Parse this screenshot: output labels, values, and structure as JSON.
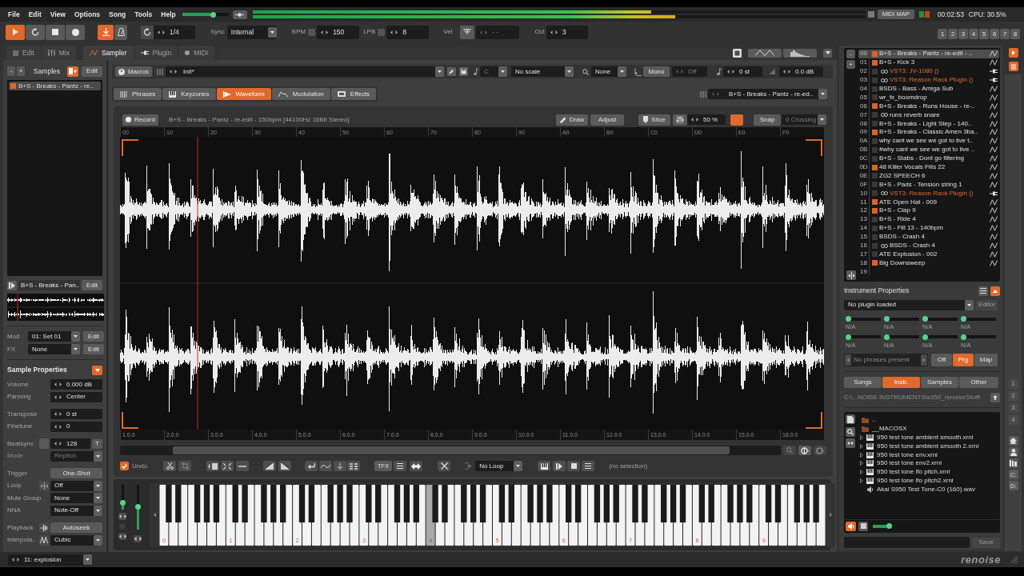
{
  "menu_bar": {
    "items": [
      "File",
      "Edit",
      "View",
      "Options",
      "Song",
      "Tools",
      "Help"
    ],
    "master_volume": {
      "level": 0.7
    },
    "meters": [
      {
        "level": 0.65
      },
      {
        "level": 0.69
      }
    ],
    "midi_map": "MIDI MAP",
    "indicators": [
      {
        "color": "#2e8b3a"
      },
      {
        "color": "#b8461e"
      }
    ],
    "time": "00:02:53",
    "cpu": "CPU: 30.5%"
  },
  "transport": {
    "buttons": [
      {
        "kind": "play",
        "on": true
      },
      {
        "kind": "loop",
        "on": false
      },
      {
        "kind": "stop",
        "on": false
      },
      {
        "kind": "record",
        "on": false
      }
    ],
    "follow": {
      "on": true
    },
    "metronome": {
      "on": false
    },
    "block_loop": "1/4",
    "sync": {
      "label": "Sync",
      "value": "Internal"
    },
    "bpm": {
      "label": "BPM",
      "checked": false,
      "value": "150"
    },
    "lpb": {
      "label": "LPB",
      "checked": false,
      "value": "8"
    },
    "velocity": {
      "label": "Vel",
      "value": "- -",
      "disabled": true
    },
    "octave": {
      "label": "Oct",
      "value": "3"
    },
    "pattern_buttons": [
      "1",
      "2",
      "3",
      "4",
      "5",
      "6",
      "7",
      "8"
    ]
  },
  "view_tabs": [
    {
      "label": "Edit",
      "selected": false
    },
    {
      "label": "Mix",
      "selected": false
    }
  ],
  "editor_tabs": [
    {
      "label": "Sampler",
      "selected": true
    },
    {
      "label": "Plugin",
      "selected": false
    },
    {
      "label": "MIDI",
      "selected": false
    }
  ],
  "samples": {
    "remove": "-",
    "add": "+",
    "title": "Samples",
    "edit": "Edit",
    "items": [
      {
        "name": "B+S - Breaks - Pantz - re..",
        "color": "#e0692c",
        "selected": true
      }
    ],
    "current": {
      "name": "B+S - Breaks - Pan..",
      "edit": "Edit"
    },
    "mod": {
      "label": "Mod",
      "value": "01: Set 01",
      "edit": "Edit"
    },
    "fx": {
      "label": "FX",
      "value": "None",
      "edit": "Edit"
    }
  },
  "sample_properties": {
    "title": "Sample Properties",
    "groups": [
      [
        {
          "label": "Volume",
          "kind": "spinner",
          "value": "0.000 dB",
          "disabled": false
        },
        {
          "label": "Panning",
          "kind": "spinner",
          "value": "Center",
          "disabled": false
        }
      ],
      [
        {
          "label": "Transpose",
          "kind": "spinner",
          "value": "0 st",
          "disabled": false
        },
        {
          "label": "Finetune",
          "kind": "spinner",
          "value": "0",
          "disabled": false
        }
      ],
      [
        {
          "label": "Beatsync",
          "kind": "spinner",
          "value": "128",
          "disabled": false,
          "checkbox": {
            "checked": false
          },
          "toggle": "T"
        },
        {
          "label": "Mode",
          "kind": "dropdown",
          "value": "Repitch",
          "disabled": true
        }
      ],
      [
        {
          "label": "Trigger",
          "kind": "button",
          "value": "One-Shot",
          "disabled": false
        },
        {
          "label": "Loop",
          "kind": "dropdown",
          "value": "Off",
          "disabled": false
        },
        {
          "label": "Mute Group",
          "kind": "dropdown",
          "value": "None",
          "disabled": false
        },
        {
          "label": "NNA",
          "kind": "dropdown",
          "value": "Note-Off",
          "disabled": false
        }
      ],
      [
        {
          "label": "Playback",
          "kind": "button",
          "value": "Autoseek",
          "disabled": false
        },
        {
          "label": "Interpola..",
          "kind": "dropdown",
          "value": "Cubic",
          "disabled": false
        }
      ]
    ]
  },
  "instrument_bar": {
    "macros": "Macros",
    "preset": "Init*",
    "key": {
      "value": "C",
      "disabled": true
    },
    "scale": "No scale",
    "quantize": "None",
    "mono": "Mono",
    "glide": {
      "value": "Off",
      "disabled": true
    },
    "transpose": "0 st",
    "volume": "0.0 dB"
  },
  "sampler_tabs": [
    {
      "label": "Phrases",
      "selected": false
    },
    {
      "label": "Keyzones",
      "selected": false
    },
    {
      "label": "Waveform",
      "selected": true
    },
    {
      "label": "Modulation",
      "selected": false
    },
    {
      "label": "Effects",
      "selected": false
    }
  ],
  "sample_selector": "B+S - Breaks - Pantz - re-ed..",
  "waveform_editor": {
    "record": "Record",
    "title": "B+S - Breaks - Pantz - re-edit - 150bpm [44100Hz 16Bit Stereo]",
    "draw": "Draw",
    "adjust": "Adjust",
    "slice": "Slice",
    "amount": "50 %",
    "toggle": {
      "on": true
    },
    "snap": "Snap",
    "snap_mode": {
      "value": "0 Crossing",
      "disabled": true
    },
    "top_ruler": [
      "00",
      "10",
      "20",
      "30",
      "40",
      "50",
      "60",
      "70",
      "80",
      "90",
      "A0",
      "B0",
      "C0",
      "D0",
      "E0",
      "F0"
    ],
    "bottom_ruler": [
      "1.0.0",
      "2.0.0",
      "3.0.0",
      "4.0.0",
      "5.0.0",
      "6.0.0",
      "7.0.0",
      "8.0.0",
      "9.0.0",
      "10.0.0",
      "11.0.0",
      "12.0.0",
      "13.0.0",
      "14.0.0",
      "15.0.0",
      "16.0.0"
    ],
    "undo": {
      "label": "Undo",
      "checked": true
    },
    "tfx": "TFX",
    "loop_mode": "No Loop",
    "selection": "(no selection)"
  },
  "keyboard": {
    "wheels": [
      {
        "level": 0.17
      },
      {
        "level": 0.5
      }
    ],
    "octaves": [
      {
        "label": "0",
        "selected": false
      },
      {
        "label": "1",
        "selected": false
      },
      {
        "label": "2",
        "selected": false
      },
      {
        "label": "3",
        "selected": false
      },
      {
        "label": "4",
        "selected": true
      },
      {
        "label": "5",
        "selected": false
      },
      {
        "label": "6",
        "selected": false
      },
      {
        "label": "7",
        "selected": false
      },
      {
        "label": "8",
        "selected": false
      },
      {
        "label": "9",
        "selected": false
      }
    ]
  },
  "instruments": [
    {
      "number": "00",
      "kind": "sample",
      "name": "B+S - Breaks - Pantz - re-edit - ..",
      "color": "#d9632a",
      "linked": false,
      "selected": true
    },
    {
      "number": "01",
      "kind": "sample",
      "name": "B+S - Kick 3",
      "color": "#d9632a",
      "linked": false,
      "selected": false
    },
    {
      "number": "02",
      "kind": "plugin",
      "name": "VST3: JV-1080 ()",
      "color": "#383838",
      "linked": true,
      "selected": false
    },
    {
      "number": "03",
      "kind": "plugin",
      "name": "VST3: Reason Rack Plugin ()",
      "color": "#383838",
      "linked": true,
      "selected": false
    },
    {
      "number": "04",
      "kind": "sample",
      "name": "BSDS - Bass - Amiga Sub",
      "color": "#383838",
      "linked": false,
      "selected": false
    },
    {
      "number": "05",
      "kind": "sample",
      "name": "wr_fx_boomdrop",
      "color": "#383838",
      "linked": false,
      "selected": false
    },
    {
      "number": "06",
      "kind": "sample",
      "name": "B+S - Breaks - Runs House - re-..",
      "color": "#d9632a",
      "linked": false,
      "selected": false
    },
    {
      "number": "07",
      "kind": "sample",
      "name": "runs reverb snare",
      "color": "#383838",
      "linked": true,
      "selected": false
    },
    {
      "number": "08",
      "kind": "sample",
      "name": "B+S - Breaks - Light Step - 140..",
      "color": "#383838",
      "linked": false,
      "selected": false
    },
    {
      "number": "09",
      "kind": "sample",
      "name": "B+S - Breaks - Classic Amen 3ba..",
      "color": "#d9632a",
      "linked": false,
      "selected": false
    },
    {
      "number": "0A",
      "kind": "sample",
      "name": "why cant we see we got to live t..",
      "color": "#383838",
      "linked": false,
      "selected": false
    },
    {
      "number": "0B",
      "kind": "sample",
      "name": "#why cant we see we got to live ..",
      "color": "#383838",
      "linked": false,
      "selected": false
    },
    {
      "number": "0C",
      "kind": "sample",
      "name": "B+S - Stabs - Dont go filtering",
      "color": "#383838",
      "linked": false,
      "selected": false
    },
    {
      "number": "0D",
      "kind": "sample",
      "name": "48 Killer Vocals Fills 22",
      "color": "#d9632a",
      "linked": false,
      "selected": false
    },
    {
      "number": "0E",
      "kind": "sample",
      "name": "ZG2 SPEECH 6",
      "color": "#383838",
      "linked": false,
      "selected": false
    },
    {
      "number": "0F",
      "kind": "sample",
      "name": "B+S - Pads - Tension string 1",
      "color": "#383838",
      "linked": false,
      "selected": false
    },
    {
      "number": "10",
      "kind": "plugin",
      "name": "VST3: Reason Rack Plugin ()",
      "color": "#383838",
      "linked": true,
      "selected": false
    },
    {
      "number": "11",
      "kind": "sample",
      "name": "ATE Open Hat - 009",
      "color": "#d9632a",
      "linked": false,
      "selected": false
    },
    {
      "number": "12",
      "kind": "sample",
      "name": "B+S - Clap 9",
      "color": "#d9632a",
      "linked": false,
      "selected": false
    },
    {
      "number": "13",
      "kind": "sample",
      "name": "B+S - Ride 4",
      "color": "#383838",
      "linked": false,
      "selected": false
    },
    {
      "number": "14",
      "kind": "sample",
      "name": "B+S - Fill 13 - 140bpm",
      "color": "#383838",
      "linked": false,
      "selected": false
    },
    {
      "number": "15",
      "kind": "sample",
      "name": "BSDS - Crash 4",
      "color": "#383838",
      "linked": false,
      "selected": false
    },
    {
      "number": "16",
      "kind": "sample",
      "name": "BSDS - Crash 4",
      "color": "#383838",
      "linked": true,
      "selected": false
    },
    {
      "number": "17",
      "kind": "sample",
      "name": "ATE Explosion - 002",
      "color": "#383838",
      "linked": false,
      "selected": false
    },
    {
      "number": "18",
      "kind": "sample",
      "name": "Big Downsweep",
      "color": "#d9632a",
      "linked": false,
      "selected": false
    },
    {
      "number": "19",
      "kind": "empty",
      "selected": false
    }
  ],
  "instrument_properties": {
    "title": "Instrument Properties",
    "plugin": "No plugin loaded",
    "editor": {
      "label": "Editor",
      "disabled": true
    },
    "parameters": [
      {
        "label": "N/A",
        "level": 0
      },
      {
        "label": "N/A",
        "level": 0
      },
      {
        "label": "N/A",
        "level": 0
      },
      {
        "label": "N/A",
        "level": 0
      },
      {
        "label": "N/A",
        "level": 0
      },
      {
        "label": "N/A",
        "level": 0
      },
      {
        "label": "N/A",
        "level": 0
      },
      {
        "label": "N/A",
        "level": 0
      }
    ],
    "phrases": {
      "value": "No phrases present",
      "disabled": true
    },
    "phrase_modes": [
      {
        "label": "Off",
        "selected": false
      },
      {
        "label": "Prg",
        "selected": true
      },
      {
        "label": "Map",
        "selected": false
      }
    ]
  },
  "browser": {
    "tabs": [
      {
        "label": "Songs",
        "selected": false
      },
      {
        "label": "Instr.",
        "selected": true
      },
      {
        "label": "Samples",
        "selected": false
      },
      {
        "label": "Other",
        "selected": false
      }
    ],
    "path": "C:\\...NOISE INSTRUMENTS\\s950_renoiseStuff\\",
    "files": [
      {
        "kind": "folder",
        "name": ".."
      },
      {
        "kind": "folder",
        "name": "__MACOSX"
      },
      {
        "kind": "instrument",
        "name": "950 test tone ambient smooth.xrni"
      },
      {
        "kind": "instrument",
        "name": "950 test tone ambient smooth 2.xrni"
      },
      {
        "kind": "instrument",
        "name": "950 test tone env.xrni"
      },
      {
        "kind": "instrument",
        "name": "950 test tone env2.xrni"
      },
      {
        "kind": "instrument",
        "name": "950 test tone lfo pitch.xrni"
      },
      {
        "kind": "instrument",
        "name": "950 test tone lfo pitch2.xrni"
      },
      {
        "kind": "sample",
        "name": "Akai S950 Test Tone-C0 (160).wav"
      }
    ],
    "preview_volume": {
      "level": 0.4
    },
    "save": {
      "label": "Save",
      "disabled": true
    }
  },
  "disk_slots": [
    {
      "label": "1",
      "disabled": true
    },
    {
      "label": "2",
      "disabled": true
    },
    {
      "label": "3",
      "disabled": true
    },
    {
      "label": "4",
      "disabled": true
    }
  ],
  "drives": [
    "C:",
    "D:"
  ],
  "bottom_bar": {
    "instrument": "11: explosion",
    "logo": "renoise"
  }
}
